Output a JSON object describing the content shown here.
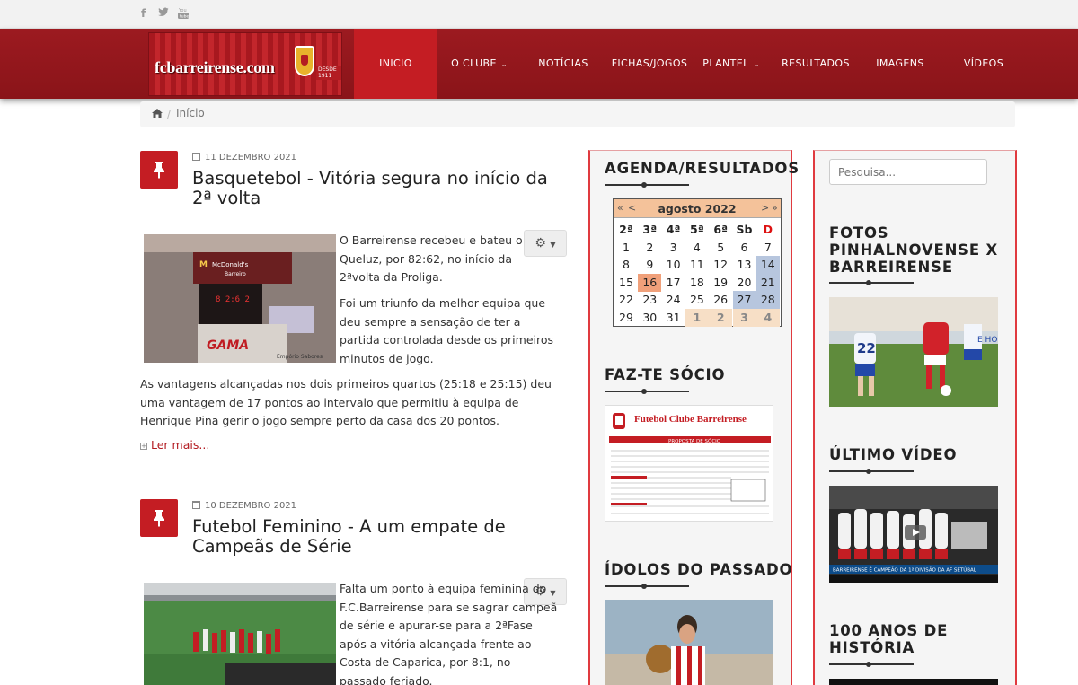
{
  "social": {
    "facebook": "f",
    "twitter": "twitter-icon",
    "youtube": "youtube-icon"
  },
  "logo": {
    "text": "fcbarreirense.com",
    "since": "DESDE 1911"
  },
  "nav": [
    {
      "label": "INICIO",
      "active": true
    },
    {
      "label": "O CLUBE",
      "dropdown": true
    },
    {
      "label": "NOTÍCIAS"
    },
    {
      "label": "FICHAS/JOGOS"
    },
    {
      "label": "PLANTEL",
      "dropdown": true
    },
    {
      "label": "RESULTADOS"
    },
    {
      "label": "IMAGENS"
    },
    {
      "label": "VÍDEOS"
    }
  ],
  "breadcrumb": {
    "current": "Início"
  },
  "articles": [
    {
      "date": "11 DEZEMBRO 2021",
      "title": "Basquetebol - Vitória segura no início da 2ª volta",
      "photo_text_1": "McDonald's",
      "photo_text_2": "Barreiro",
      "photo_text_3": "GAMA",
      "photo_text_4": "Empório Sabores",
      "paragraph_1": "O Barreirense recebeu e bateu o Queluz, por 82:62, no início da 2ªvolta da Proliga.",
      "paragraph_2": "Foi um triunfo da melhor equipa que deu sempre a sensação de ter a partida controlada desde os primeiros minutos de jogo.",
      "paragraph_3": "As vantagens alcançadas nos dois primeiros quartos (25:18 e 25:15) deu uma vantagem de 17 pontos ao intervalo que permitiu à equipa de Henrique Pina gerir o jogo sempre perto da casa dos 20 pontos.",
      "read_more": "Ler mais..."
    },
    {
      "date": "10 DEZEMBRO 2021",
      "title": "Futebol Feminino - A um empate de Campeãs de Série",
      "paragraph_1": "Falta um ponto à equipa feminina do F.C.Barreirense para se sagrar campeã de série e apurar-se para a 2ªFase após a vitória alcançada frente ao Costa de Caparica, por 8:1, no passado feriado."
    }
  ],
  "agenda": {
    "title": "AGENDA/RESULTADOS",
    "month": "agosto 2022",
    "nav_prev_year": "«",
    "nav_prev": "<",
    "nav_next": ">",
    "nav_next_year": "»",
    "weekdays": [
      "2ª",
      "3ª",
      "4ª",
      "5ª",
      "6ª",
      "Sb",
      "D"
    ],
    "weeks": [
      [
        "1",
        "2",
        "3",
        "4",
        "5",
        "6",
        "7"
      ],
      [
        "8",
        "9",
        "10",
        "11",
        "12",
        "13",
        "14"
      ],
      [
        "15",
        "16",
        "17",
        "18",
        "19",
        "20",
        "21"
      ],
      [
        "22",
        "23",
        "24",
        "25",
        "26",
        "27",
        "28"
      ],
      [
        "29",
        "30",
        "31",
        "1",
        "2",
        "3",
        "4"
      ]
    ]
  },
  "socio": {
    "title": "FAZ-TE SÓCIO",
    "form_header": "Futebol Clube Barreirense",
    "form_title": "PROPOSTA DE SÓCIO"
  },
  "idolos": {
    "title": "ÍDOLOS DO PASSADO"
  },
  "search": {
    "placeholder": "Pesquisa..."
  },
  "fotos": {
    "title": "FOTOS PINHALNOVENSE X BARREIRENSE"
  },
  "video": {
    "title": "ÚLTIMO VÍDEO",
    "caption": "BARREIRENSE É CAMPEÃO DA 1ª DIVISÃO DA AF SETÚBAL"
  },
  "historia": {
    "title": "100 ANOS DE HISTÓRIA"
  },
  "colors": {
    "brand_red": "#c41d23",
    "header_red": "#9c1a20",
    "calendar_head": "#f4c29a",
    "calendar_weekend": "#b7c6de",
    "calendar_today": "#f0a07a"
  }
}
